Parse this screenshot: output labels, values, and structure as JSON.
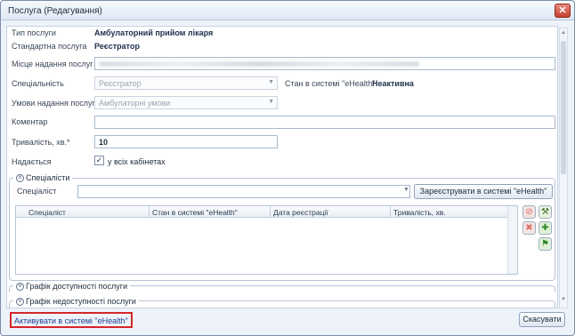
{
  "window": {
    "title": "Послуга (Редагування)"
  },
  "form": {
    "service_type_label": "Тип послуги",
    "service_type_value": "Амбулаторний прийом лікаря",
    "standard_service_label": "Стандартна послуга",
    "standard_service_value": "Реєстратор",
    "place_label": "Місце надання послуг",
    "specialty_label": "Спеціальність",
    "specialty_value": "Реєстратор",
    "ehealth_state_label": "Стан в системі \"eHealth\"",
    "ehealth_state_value": "Неактивна",
    "conditions_label": "Умови надання послуг",
    "conditions_value": "Амбулаторні умови",
    "comment_label": "Коментар",
    "comment_value": "",
    "duration_label": "Тривалість, хв.*",
    "duration_value": "10",
    "provided_label": "Надається",
    "all_rooms_checked": true,
    "all_rooms_label": "у всіх кабінетах"
  },
  "specialists": {
    "header": "Спеціалісти",
    "specialist_label": "Спеціаліст",
    "specialist_value": "",
    "register_button": "Зареєструвати в системі \"eHealth\"",
    "columns": [
      "Спеціаліст",
      "Стан в системі \"eHealth\"",
      "Дата реєстрації",
      "Тривалість, хв."
    ]
  },
  "sections": {
    "availability": "Графік доступності послуги",
    "unavailability": "Графік недоступності послуги"
  },
  "footer": {
    "activate_link": "Активувати в системі \"eHealth\"",
    "cancel_button": "Скасувати"
  },
  "icons": {
    "close": "close-icon",
    "collapse": "chevron-up-icon",
    "expand": "chevron-down-icon",
    "delete": "delete-icon",
    "remove": "remove-icon",
    "wrench": "wrench-icon",
    "add": "add-icon",
    "flag": "flag-icon"
  },
  "colors": {
    "accent": "#1e3d8f",
    "highlight_border": "#d5262a",
    "close": "#c2412f"
  }
}
